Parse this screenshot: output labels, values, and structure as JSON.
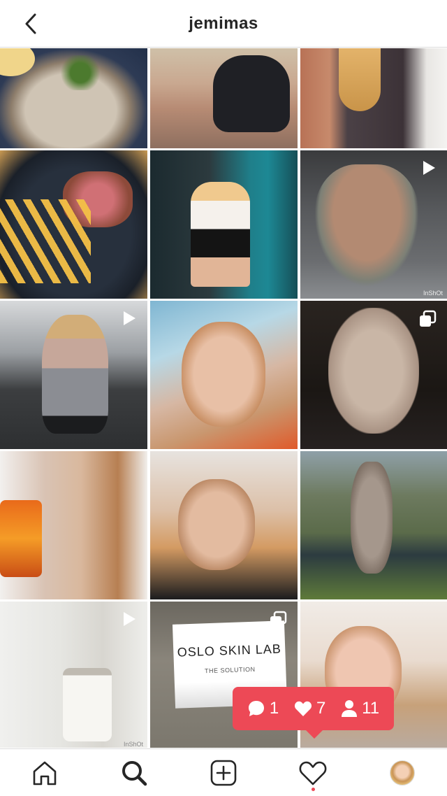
{
  "header": {
    "title": "jemimas"
  },
  "grid": {
    "tiles": [
      {
        "name": "post-risotto",
        "badge": null
      },
      {
        "name": "post-selfie-black-top",
        "badge": null
      },
      {
        "name": "post-grey-sweater",
        "badge": null
      },
      {
        "name": "post-steak-fries",
        "badge": null
      },
      {
        "name": "post-mirror-selfie",
        "badge": null
      },
      {
        "name": "post-gym-back",
        "badge": "video",
        "watermark": "InShOt"
      },
      {
        "name": "post-gym-rowing",
        "badge": "video"
      },
      {
        "name": "post-selfie-orange",
        "badge": null
      },
      {
        "name": "post-puppy",
        "badge": "carousel"
      },
      {
        "name": "post-drink-selfie",
        "badge": null
      },
      {
        "name": "post-selfie-bright",
        "badge": null
      },
      {
        "name": "post-dog-bench",
        "badge": null
      },
      {
        "name": "post-protein-jar",
        "badge": "video",
        "watermark": "InShOt"
      },
      {
        "name": "post-oslo-skin-lab",
        "badge": "carousel",
        "brand": "OSLO SKIN LAB",
        "subtitle": "THE SOLUTION"
      },
      {
        "name": "post-selfie-curly",
        "badge": null
      }
    ]
  },
  "activity": {
    "comments": "1",
    "likes": "7",
    "follows": "11",
    "color": "#ed4956"
  },
  "nav": {
    "items": [
      "home-icon",
      "search-icon",
      "add-post-icon",
      "activity-heart-icon",
      "profile-avatar"
    ]
  }
}
